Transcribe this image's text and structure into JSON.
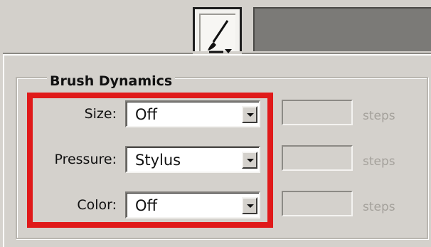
{
  "toolbar": {
    "brush_tool_icon": "brush-icon"
  },
  "panel": {
    "group_title": "Brush Dynamics",
    "rows": [
      {
        "label": "Size:",
        "value": "Off",
        "steps_label": "steps"
      },
      {
        "label": "Pressure:",
        "value": "Stylus",
        "steps_label": "steps"
      },
      {
        "label": "Color:",
        "value": "Off",
        "steps_label": "steps"
      }
    ]
  },
  "highlight": {
    "color": "#e01a1a"
  }
}
